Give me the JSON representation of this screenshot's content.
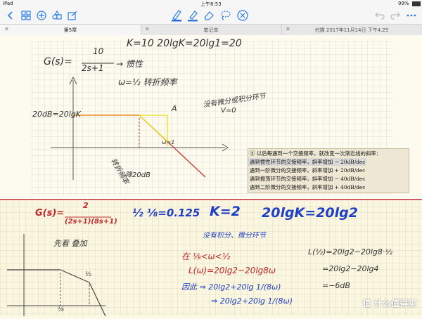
{
  "status": {
    "device": "iPad",
    "time": "上午8:53",
    "battery": "99%"
  },
  "toolbar": {
    "left_icons": [
      "grid-icon",
      "add-icon",
      "shapes-icon",
      "edit-icon"
    ],
    "tools": [
      "pen-icon",
      "highlighter-icon",
      "eraser-icon",
      "lasso-icon",
      "delete-icon"
    ],
    "pen_color": "#2a6fd6",
    "highlighter_color": "#3a7ad8"
  },
  "tabs": [
    {
      "label": "第5章"
    },
    {
      "label": "笔记本"
    },
    {
      "label": "扫描 2017年11月14日 下午4.25"
    }
  ],
  "notes": {
    "top_eq": "K=10   20lgK=20lg1=20",
    "g_eq": "G(s)=",
    "g_num": "10",
    "g_den": "2s+1",
    "inertia": "→ 惯性",
    "omega": "ω=½  转折频率",
    "ylabel": "20dB=20lgK",
    "point_a": "A",
    "omega_label": "ω=1",
    "note_right": "没有微分或积分环节",
    "note_v": "V=0",
    "note_bottom1": "转折频率",
    "note_bottom2": "降20dB",
    "printed_title": "⑤ 以后每遇到一个交接频率，就改变一次渐近线的斜率：",
    "printed_lines": [
      "遇到惯性环节的交接频率，斜率增加 − 20dB/dec",
      "遇到一阶微分的交接频率，斜率增加 + 20dB/dec",
      "遇到振荡环节的交接频率，斜率增加 − 40dB/dec",
      "遇到二阶微分的交接频率，斜率增加 + 40dB/dec"
    ],
    "g2": "G(s)=",
    "g2_num": "2",
    "g2_den": "(2s+1)(8s+1)",
    "freqs": "½   ⅛=0.125",
    "k2": "K=2",
    "k2eq": "20lgK=20lg2",
    "note_nodiff": "没有积分、微分环节",
    "note_first": "先看 叠加",
    "range": "在 ⅛<ω<½",
    "l_eq": "L(ω)=20lg2−20lg8ω",
    "hence": "因此 ⇒ 20lg2+20lg 1/(8ω)",
    "hence2": "⇒ 20lg2+20lg 1/(8ω)",
    "right1": "L(½)=20lg2−20lg8·½",
    "right2": "=20lg2−20lg4",
    "right3": "=−6dB",
    "axis_tick_a": "⅛",
    "axis_tick_b": "½"
  },
  "watermark": "值 什么值得买"
}
